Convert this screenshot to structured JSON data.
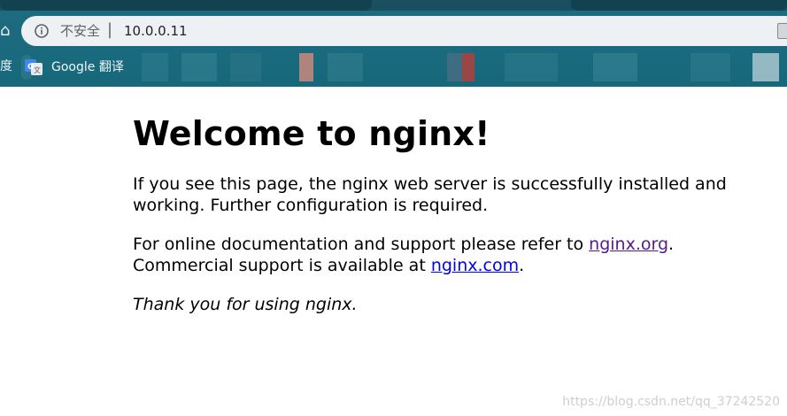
{
  "browser": {
    "security_label": "不安全",
    "security_separator": "|",
    "url": "10.0.0.11",
    "bookmark_cut_char": "度",
    "bookmarks": [
      {
        "label": "Google 翻译",
        "icon": "google-translate-icon"
      }
    ],
    "blurred_bookmark_colors": [
      "#2f7d8f",
      "#3a8898",
      "#2b7788",
      "#c9897d",
      "#347f91",
      "#b0413c",
      "#2f7d8f",
      "#3b8a9b"
    ]
  },
  "page": {
    "heading": "Welcome to nginx!",
    "paragraph1": "If you see this page, the nginx web server is successfully installed and working. Further configuration is required.",
    "paragraph2_prefix": "For online documentation and support please refer to ",
    "link_org": "nginx.org",
    "paragraph2_mid": ".",
    "paragraph3_prefix": "Commercial support is available at ",
    "link_com": "nginx.com",
    "paragraph3_suffix": ".",
    "thanks": "Thank you for using nginx."
  },
  "watermark": "https://blog.csdn.net/qq_37242520",
  "colors": {
    "chrome_teal": "#1b6a7e",
    "link_visited": "#551a8b",
    "link_unvisited": "#0000ee"
  }
}
